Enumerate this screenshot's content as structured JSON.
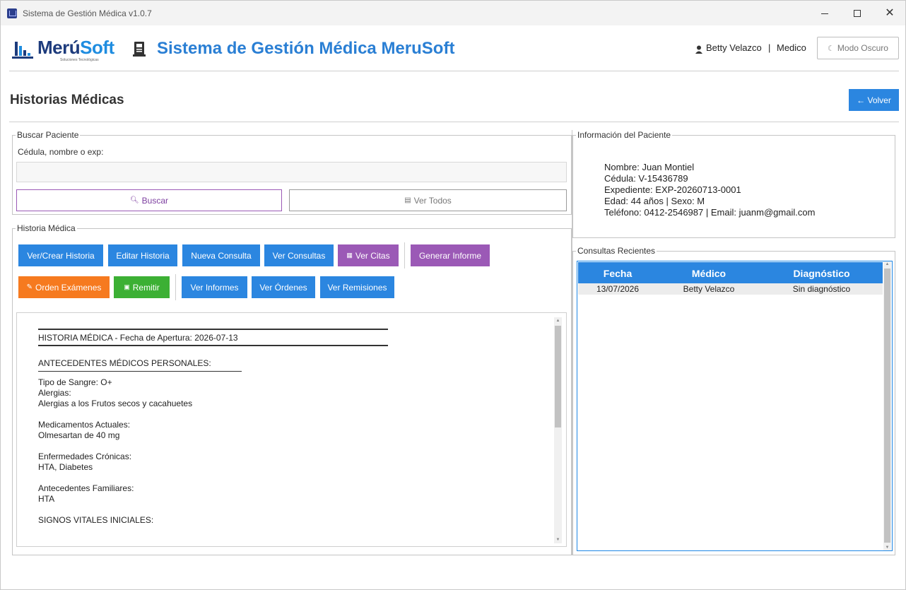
{
  "window": {
    "title": "Sistema de Gestión Médica v1.0.7"
  },
  "header": {
    "logo_text_a": "Merú",
    "logo_text_b": "Soft",
    "logo_sub": "Soluciones Tecnológicas",
    "app_title": "Sistema de Gestión Médica MeruSoft",
    "user_name": "Betty Velazco",
    "user_sep": "|",
    "user_role": "Medico",
    "dark_mode_label": "Modo Oscuro"
  },
  "page": {
    "title": "Historias Médicas",
    "back_label": "← Volver"
  },
  "search": {
    "group_label": "Buscar Paciente",
    "field_label": "Cédula, nombre o exp:",
    "value": "",
    "search_label": "Buscar",
    "view_all_label": "Ver Todos"
  },
  "history": {
    "group_label": "Historia Médica",
    "buttons": {
      "ver_crear": "Ver/Crear Historia",
      "editar": "Editar Historia",
      "nueva_consulta": "Nueva Consulta",
      "ver_consultas": "Ver Consultas",
      "ver_citas": "Ver Citas",
      "generar_informe": "Generar Informe",
      "orden_examenes": "Orden Exámenes",
      "remitir": "Remitir",
      "ver_informes": "Ver Informes",
      "ver_ordenes": "Ver Órdenes",
      "ver_remisiones": "Ver Remisiones"
    },
    "text": {
      "heading": "HISTORIA MÉDICA - Fecha de Apertura: 2026-07-13",
      "section_personal": "ANTECEDENTES MÉDICOS PERSONALES:",
      "blood_type": "Tipo de Sangre: O+",
      "allergies_label": "Alergias:",
      "allergies_value": "Alergias a los Frutos secos y cacahuetes",
      "meds_label": "Medicamentos Actuales:",
      "meds_value": "Olmesartan de 40 mg",
      "chronic_label": "Enfermedades Crónicas:",
      "chronic_value": "HTA, Diabetes",
      "family_label": "Antecedentes Familiares:",
      "family_value": "HTA",
      "vitals_label": "SIGNOS VITALES INICIALES:"
    }
  },
  "patient": {
    "group_label": "Información del Paciente",
    "name": "Nombre: Juan Montiel",
    "cedula": "Cédula: V-15436789",
    "expediente": "Expediente: EXP-20260713-0001",
    "age_sex": "Edad: 44 años | Sexo: M",
    "contact": "Teléfono: 0412-2546987 | Email: juanm@gmail.com"
  },
  "consultas": {
    "group_label": "Consultas Recientes",
    "columns": [
      "Fecha",
      "Médico",
      "Diagnóstico"
    ],
    "rows": [
      [
        "13/07/2026",
        "Betty Velazco",
        "Sin diagnóstico"
      ]
    ]
  },
  "colors": {
    "primary_blue": "#2b86e0",
    "purple": "#9b59b6",
    "orange": "#f67a1f",
    "green": "#3cb034",
    "title_blue": "#2a7fd4"
  },
  "icons": {
    "window": "app-icon",
    "user": "user-icon",
    "dark_mode": "moon-icon",
    "search": "magnifier-icon",
    "view_all": "list-icon",
    "calendar": "calendar-icon",
    "pencil": "pencil-icon",
    "refer": "referral-icon"
  }
}
